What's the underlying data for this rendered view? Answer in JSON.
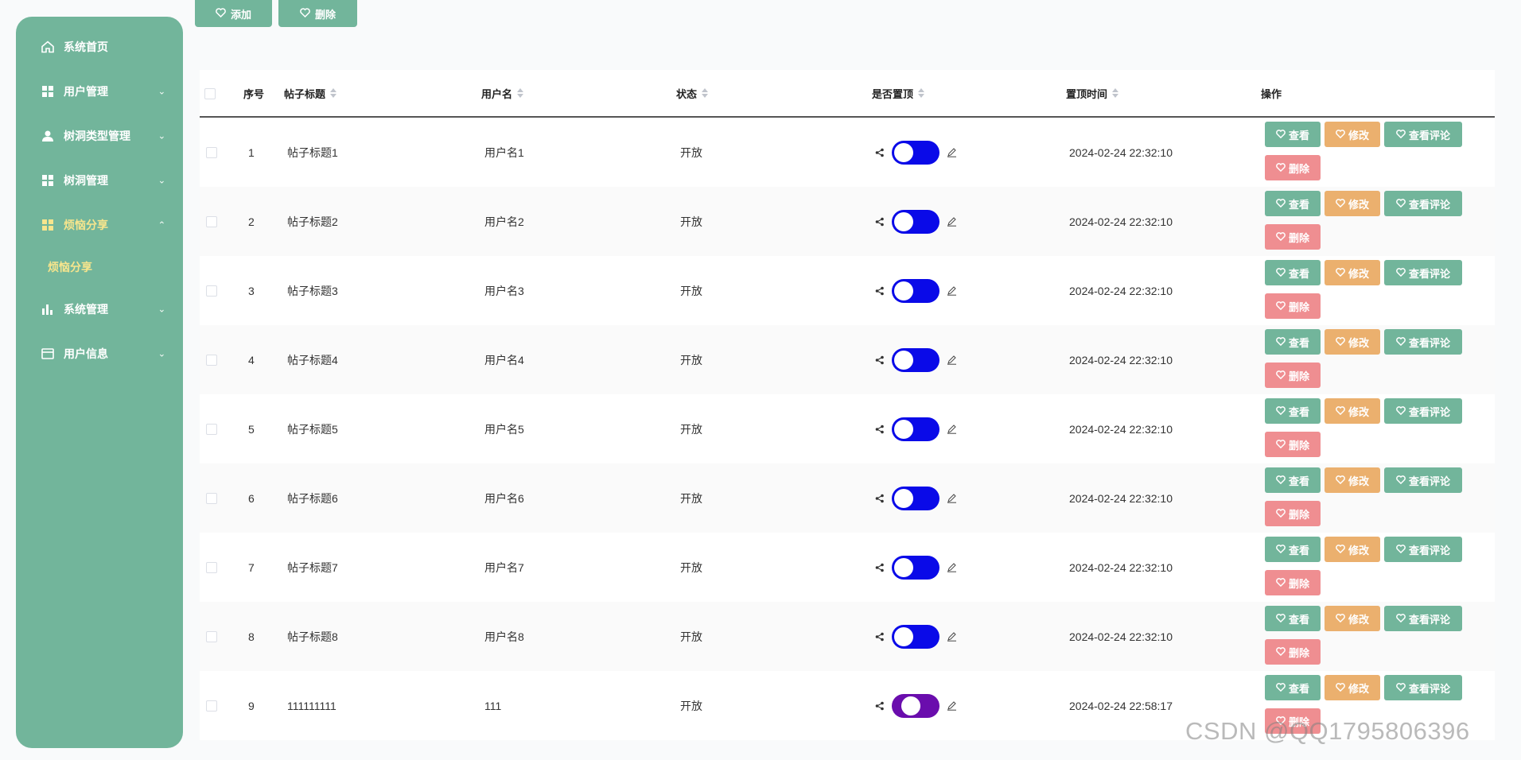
{
  "toolbar": {
    "add_label": "添加",
    "delete_label": "删除"
  },
  "sidebar": {
    "items": [
      {
        "label": "系统首页",
        "icon": "home-icon",
        "chevron": ""
      },
      {
        "label": "用户管理",
        "icon": "grid-icon",
        "chevron": "⌄"
      },
      {
        "label": "树洞类型管理",
        "icon": "user-icon",
        "chevron": "⌄"
      },
      {
        "label": "树洞管理",
        "icon": "grid-icon",
        "chevron": "⌄"
      },
      {
        "label": "烦恼分享",
        "icon": "grid-icon",
        "chevron": "⌃"
      },
      {
        "label": "系统管理",
        "icon": "bar-chart-icon",
        "chevron": "⌄"
      },
      {
        "label": "用户信息",
        "icon": "card-icon",
        "chevron": "⌄"
      }
    ],
    "submenu": {
      "label": "烦恼分享"
    }
  },
  "table": {
    "headers": {
      "index": "序号",
      "title": "帖子标题",
      "username": "用户名",
      "status": "状态",
      "pinned": "是否置顶",
      "pinned_time": "置顶时间",
      "actions": "操作"
    },
    "actions": {
      "view": "查看",
      "edit": "修改",
      "comments": "查看评论",
      "delete": "删除"
    },
    "rows": [
      {
        "index": "1",
        "title": "帖子标题1",
        "username": "用户名1",
        "status": "开放",
        "time": "2024-02-24 22:32:10"
      },
      {
        "index": "2",
        "title": "帖子标题2",
        "username": "用户名2",
        "status": "开放",
        "time": "2024-02-24 22:32:10"
      },
      {
        "index": "3",
        "title": "帖子标题3",
        "username": "用户名3",
        "status": "开放",
        "time": "2024-02-24 22:32:10"
      },
      {
        "index": "4",
        "title": "帖子标题4",
        "username": "用户名4",
        "status": "开放",
        "time": "2024-02-24 22:32:10"
      },
      {
        "index": "5",
        "title": "帖子标题5",
        "username": "用户名5",
        "status": "开放",
        "time": "2024-02-24 22:32:10"
      },
      {
        "index": "6",
        "title": "帖子标题6",
        "username": "用户名6",
        "status": "开放",
        "time": "2024-02-24 22:32:10"
      },
      {
        "index": "7",
        "title": "帖子标题7",
        "username": "用户名7",
        "status": "开放",
        "time": "2024-02-24 22:32:10"
      },
      {
        "index": "8",
        "title": "帖子标题8",
        "username": "用户名8",
        "status": "开放",
        "time": "2024-02-24 22:32:10"
      },
      {
        "index": "9",
        "title": "111111111",
        "username": "111",
        "status": "开放",
        "time": "2024-02-24 22:58:17"
      }
    ]
  },
  "colors": {
    "primary": "#72b59b",
    "warning": "#ebb06e",
    "danger": "#ef8e91",
    "switch_on": "#0a0ae8",
    "switch_hover": "#6a0dad",
    "active_menu": "#f6e58d"
  },
  "watermark": "CSDN @QQ1795806396"
}
